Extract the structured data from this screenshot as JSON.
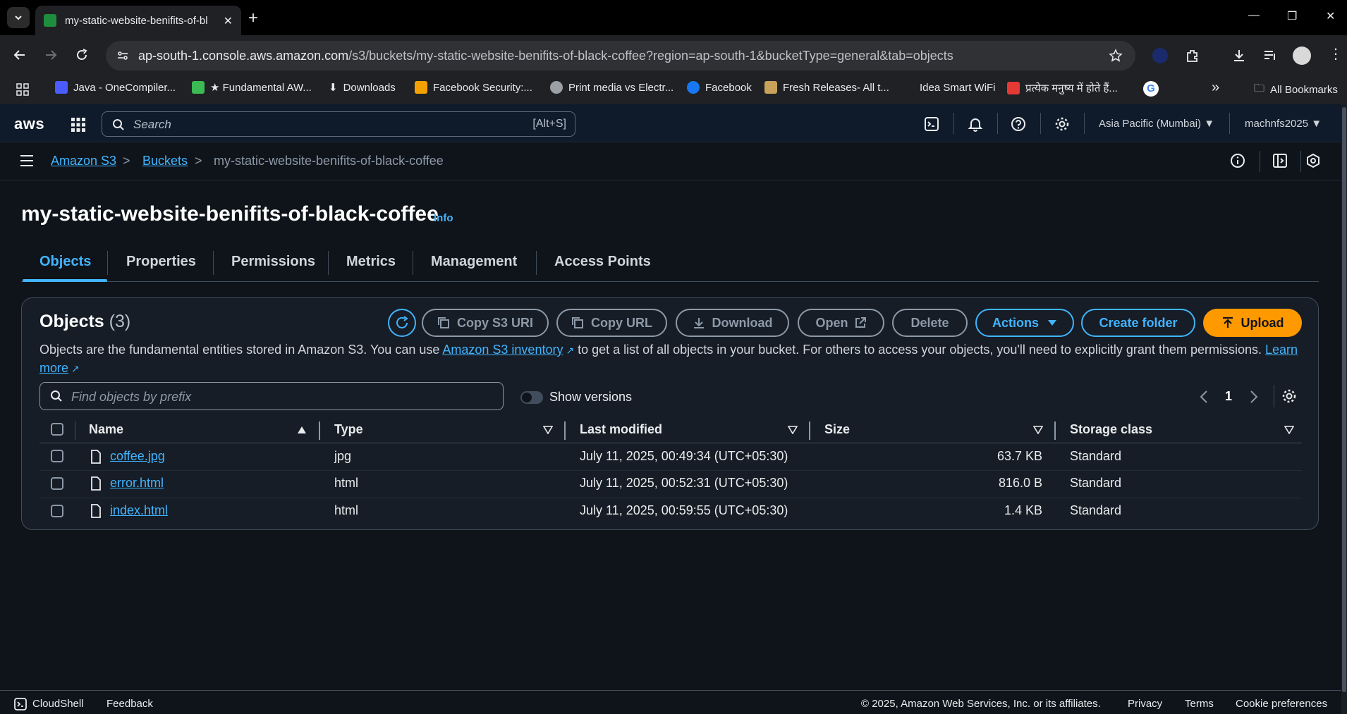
{
  "browser": {
    "tab_title": "my-static-website-benifits-of-bl",
    "url_host": "ap-south-1.console.aws.amazon.com",
    "url_path": "/s3/buckets/my-static-website-benifits-of-black-coffee?region=ap-south-1&bucketType=general&tab=objects",
    "bookmarks": [
      {
        "label": "Java - OneCompiler...",
        "color": "#4a5cff"
      },
      {
        "label": "★ Fundamental AW...",
        "color": "#3cba54"
      },
      {
        "label": "Downloads",
        "color": "#e8eaed"
      },
      {
        "label": "Facebook Security:...",
        "color": "#f4a100"
      },
      {
        "label": "Print media vs Electr...",
        "color": "#9aa0a6"
      },
      {
        "label": "Facebook",
        "color": "#1877f2"
      },
      {
        "label": "Fresh Releases- All t...",
        "color": "#c8a25a"
      },
      {
        "label": "Idea Smart WiFi",
        "color": "#202124"
      },
      {
        "label": "प्रत्येक मनुष्य में होते हैं...",
        "color": "#e53935"
      }
    ],
    "all_bookmarks": "All Bookmarks"
  },
  "aws_header": {
    "logo": "aws",
    "search_placeholder": "Search",
    "search_shortcut": "[Alt+S]",
    "region": "Asia Pacific (Mumbai) ▼",
    "account": "machnfs2025 ▼"
  },
  "breadcrumb": {
    "items": [
      "Amazon S3",
      "Buckets",
      "my-static-website-benifits-of-black-coffee"
    ],
    "separator": ">"
  },
  "page": {
    "title": "my-static-website-benifits-of-black-coffee",
    "info": "Info",
    "tabs": [
      "Objects",
      "Properties",
      "Permissions",
      "Metrics",
      "Management",
      "Access Points"
    ],
    "active_tab": "Objects"
  },
  "objects_panel": {
    "title": "Objects",
    "count": "(3)",
    "buttons": {
      "copy_s3_uri": "Copy S3 URI",
      "copy_url": "Copy URL",
      "download": "Download",
      "open": "Open",
      "delete": "Delete",
      "actions": "Actions",
      "create_folder": "Create folder",
      "upload": "Upload"
    },
    "description": {
      "part1": "Objects are the fundamental entities stored in Amazon S3. You can use ",
      "link1": "Amazon S3 inventory",
      "part2": " to get a list of all objects in your bucket. For others to access your objects, you'll need to explicitly grant them permissions. ",
      "link2a": "Learn",
      "link2b": "more"
    },
    "filter_placeholder": "Find objects by prefix",
    "show_versions": "Show versions",
    "page_number": "1",
    "columns": [
      "Name",
      "Type",
      "Last modified",
      "Size",
      "Storage class"
    ],
    "rows": [
      {
        "name": "coffee.jpg",
        "type": "jpg",
        "modified": "July 11, 2025, 00:49:34 (UTC+05:30)",
        "size": "63.7 KB",
        "storage": "Standard"
      },
      {
        "name": "error.html",
        "type": "html",
        "modified": "July 11, 2025, 00:52:31 (UTC+05:30)",
        "size": "816.0 B",
        "storage": "Standard"
      },
      {
        "name": "index.html",
        "type": "html",
        "modified": "July 11, 2025, 00:59:55 (UTC+05:30)",
        "size": "1.4 KB",
        "storage": "Standard"
      }
    ]
  },
  "footer": {
    "cloudshell": "CloudShell",
    "feedback": "Feedback",
    "copyright": "© 2025, Amazon Web Services, Inc. or its affiliates.",
    "privacy": "Privacy",
    "terms": "Terms",
    "cookies": "Cookie preferences"
  },
  "colors": {
    "accent": "#42b4ff",
    "primary_button": "#ff9900",
    "background": "#0f141a"
  }
}
